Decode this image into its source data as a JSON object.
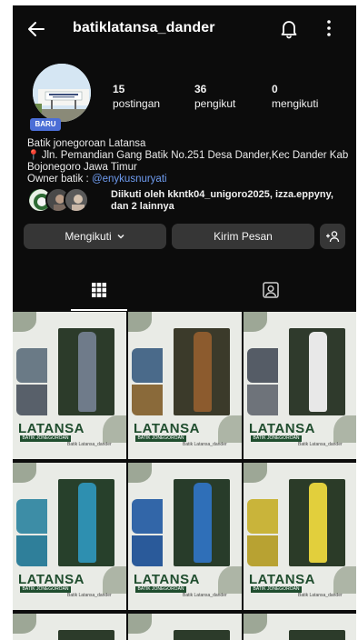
{
  "header": {
    "username": "batiklatansa_dander"
  },
  "profile": {
    "avatar_badge": "BARU",
    "stats": [
      {
        "value": "15",
        "label": "postingan"
      },
      {
        "value": "36",
        "label": "pengikut"
      },
      {
        "value": "0",
        "label": "mengikuti"
      }
    ],
    "bio": {
      "name": "Batik jonegoroan Latansa",
      "address": "Jln. Pemandian Gang Batik No.251 Desa Dander,Kec Dander Kab Bojonegoro Jawa Timur",
      "owner_prefix": "Owner batik : ",
      "owner_tag": "@enykusnuryati"
    },
    "followed_by": "Diikuti oleh kkntk04_unigoro2025, izza.eppyny, dan 2 lainnya"
  },
  "actions": {
    "follow_label": "Mengikuti",
    "message_label": "Kirim Pesan"
  },
  "posts": [
    {
      "brand": "LATANSA",
      "sub": "BATIK JONEGOROAN",
      "sig": "Batik Latansa_dander",
      "dress_color": "#6f7b8a"
    },
    {
      "brand": "LATANSA",
      "sub": "BATIK JONEGOROAN",
      "sig": "Batik Latansa_dander",
      "dress_color": "#8c5b2e"
    },
    {
      "brand": "LATANSA",
      "sub": "BATIK JONEGOROAN",
      "sig": "Batik Latansa_dander",
      "dress_color": "#e8e8e8"
    },
    {
      "brand": "LATANSA",
      "sub": "BATIK JONEGOROAN",
      "sig": "Batik Latansa_dander",
      "dress_color": "#2e8fb0"
    },
    {
      "brand": "LATANSA",
      "sub": "BATIK JONEGOROAN",
      "sig": "Batik Latansa_dander",
      "dress_color": "#2f6fb8"
    },
    {
      "brand": "LATANSA",
      "sub": "BATIK JONEGOROAN",
      "sig": "Batik Latansa_dander",
      "dress_color": "#e2cf3c"
    }
  ],
  "colors": {
    "background": "#0c0c0c",
    "button": "#363636",
    "link": "#6f9cf0",
    "badge": "#4b6ed6",
    "brand_green": "#1f4d2e"
  }
}
